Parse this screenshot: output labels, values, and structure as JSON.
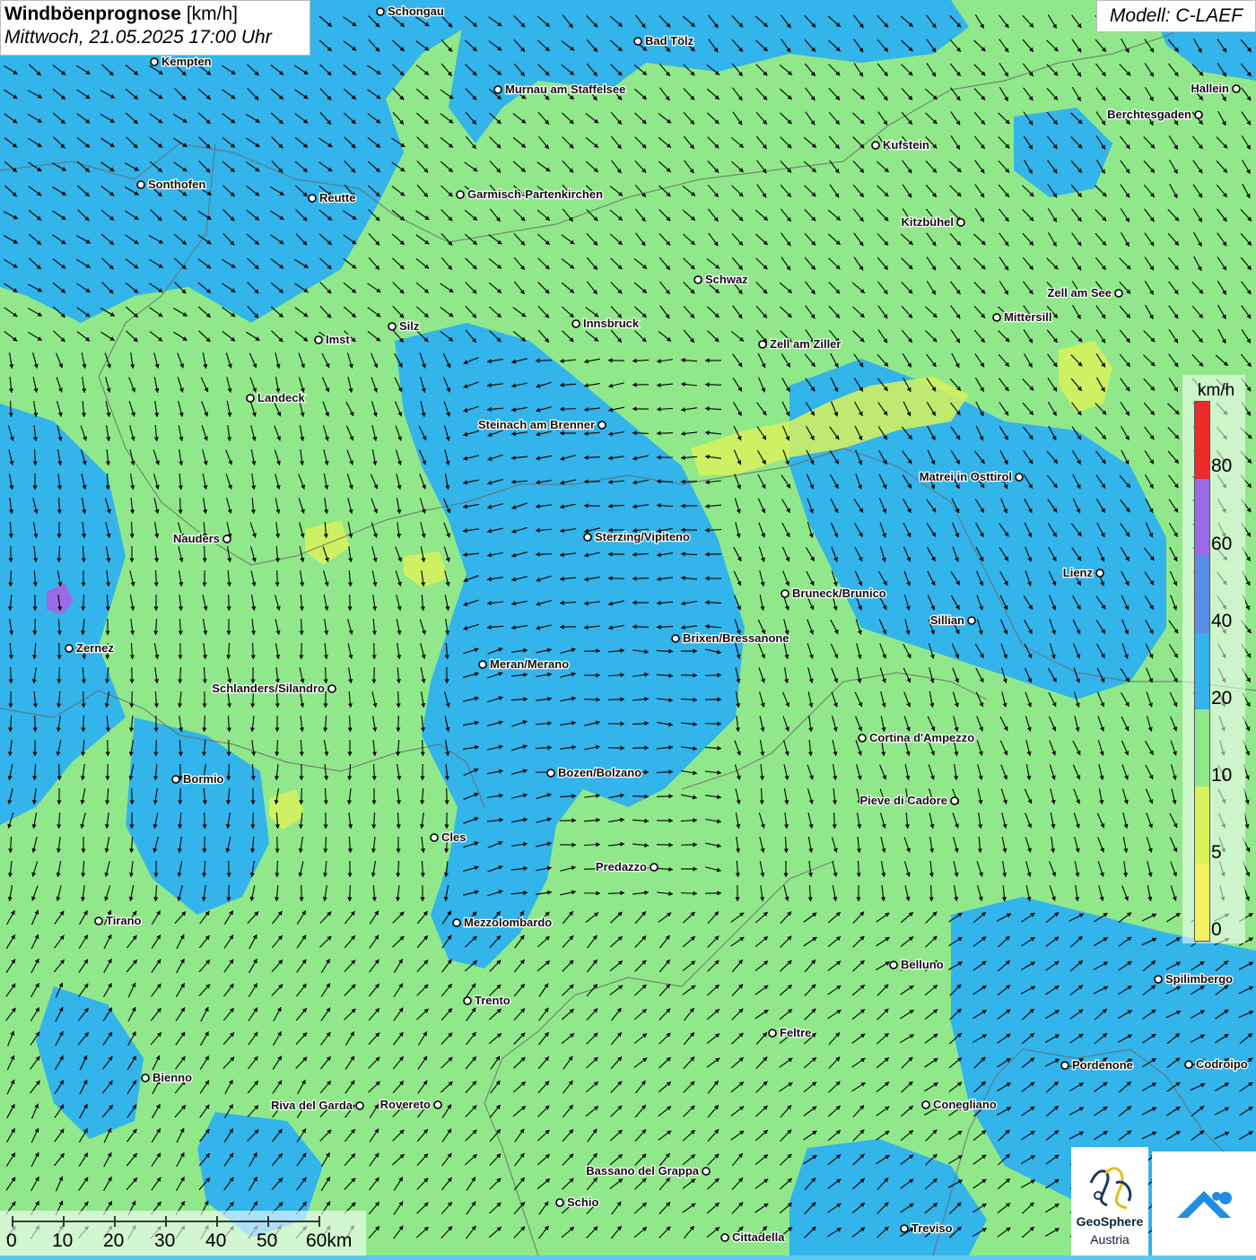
{
  "title": {
    "main": "Windböenprognose",
    "unit": "[km/h]",
    "datetime": "Mittwoch, 21.05.2025 17:00 Uhr"
  },
  "model": "Modell: C-LAEF",
  "legend": {
    "unit": "km/h",
    "levels": [
      "80",
      "60",
      "40",
      "20",
      "10",
      "5",
      "0"
    ],
    "colors": {
      "80+": "#ee2a2a",
      "60-80": "#9b6ae6",
      "40-60": "#5a8ee6",
      "20-40": "#33b4ea",
      "10-20": "#90e88a",
      "5-10": "#d8f25a",
      "0-5": "#f4f260"
    }
  },
  "scale_bar": {
    "labels": [
      "0",
      "10",
      "20",
      "30",
      "40",
      "50",
      "60km"
    ]
  },
  "logo": {
    "name": "GeoSphere",
    "sub": "Austria"
  },
  "colors": {
    "water_bg": "#5cc8ee",
    "gust_10_20": "#90e88a",
    "gust_20_40": "#33b4ea",
    "gust_5_10": "#d8f25a"
  },
  "places": [
    {
      "name": "Schongau"
    },
    {
      "name": "Bad Tölz"
    },
    {
      "name": "Kempten"
    },
    {
      "name": "Murnau am Staffelsee"
    },
    {
      "name": "Hallein"
    },
    {
      "name": "Berchtesgaden"
    },
    {
      "name": "Kufstein"
    },
    {
      "name": "Sonthofen"
    },
    {
      "name": "Reutte"
    },
    {
      "name": "Garmisch-Partenkirchen"
    },
    {
      "name": "Kitzbühel"
    },
    {
      "name": "Schwaz"
    },
    {
      "name": "Zell am See"
    },
    {
      "name": "Mittersill"
    },
    {
      "name": "Innsbruck"
    },
    {
      "name": "Silz"
    },
    {
      "name": "Imst"
    },
    {
      "name": "Zell am Ziller"
    },
    {
      "name": "Landeck"
    },
    {
      "name": "Steinach am Brenner"
    },
    {
      "name": "Matrei in Osttirol"
    },
    {
      "name": "Nauders"
    },
    {
      "name": "Sterzing/Vipiteno"
    },
    {
      "name": "Lienz"
    },
    {
      "name": "Bruneck/Brunico"
    },
    {
      "name": "Sillian"
    },
    {
      "name": "Brixen/Bressanone"
    },
    {
      "name": "Zernez"
    },
    {
      "name": "Meran/Merano"
    },
    {
      "name": "Schlanders/Silandro"
    },
    {
      "name": "Cortina d'Ampezzo"
    },
    {
      "name": "Bozen/Bolzano"
    },
    {
      "name": "Bormio"
    },
    {
      "name": "Pieve di Cadore"
    },
    {
      "name": "Cles"
    },
    {
      "name": "Predazzo"
    },
    {
      "name": "Tirano"
    },
    {
      "name": "Mezzolombardo"
    },
    {
      "name": "Belluno"
    },
    {
      "name": "Spilimbergo"
    },
    {
      "name": "Trento"
    },
    {
      "name": "Feltre"
    },
    {
      "name": "Pordenone"
    },
    {
      "name": "Codroipo"
    },
    {
      "name": "Bienno"
    },
    {
      "name": "Riva del Garda"
    },
    {
      "name": "Rovereto"
    },
    {
      "name": "Conegliano"
    },
    {
      "name": "Bassano del Grappa"
    },
    {
      "name": "Schio"
    },
    {
      "name": "Treviso"
    },
    {
      "name": "Cittadella"
    }
  ]
}
